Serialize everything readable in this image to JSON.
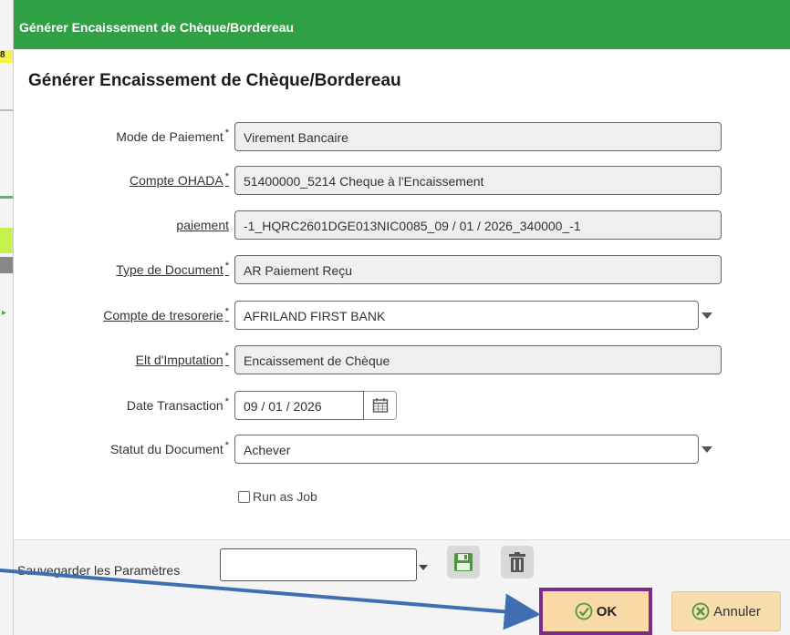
{
  "background": {
    "fragment_text": "8"
  },
  "dialog": {
    "window_title": "Générer Encaissement de Chèque/Bordereau",
    "heading": "Générer Encaissement de Chèque/Bordereau",
    "required_mark": "*",
    "fields": {
      "mode_paiement": {
        "label": "Mode de Paiement",
        "value": "Virement Bancaire"
      },
      "compte_ohada": {
        "label": "Compte OHADA",
        "value": "51400000_5214 Cheque à l'Encaissement"
      },
      "paiement": {
        "label": "paiement",
        "value": "-1_HQRC2601DGE013NIC0085_09 / 01 / 2026_340000_-1"
      },
      "type_document": {
        "label": "Type de Document",
        "value": "AR Paiement Reçu"
      },
      "compte_tresorerie": {
        "label": "Compte de tresorerie",
        "value": "AFRILAND FIRST BANK"
      },
      "elt_imputation": {
        "label": "Elt d'Imputation",
        "value": "Encaissement de Chèque"
      },
      "date_transaction": {
        "label": "Date Transaction",
        "value": "09 / 01 / 2026"
      },
      "statut_document": {
        "label": "Statut du Document",
        "value": "Achever"
      }
    },
    "run_as_job": {
      "label": "Run as Job",
      "checked": false
    },
    "footer": {
      "save_params_label": "Sauvegarder les Paramètres",
      "save_params_value": "",
      "ok_label": "OK",
      "cancel_label": "Annuler"
    }
  },
  "colors": {
    "title_bar": "#2fa043",
    "ok_highlight_border": "#7a2c88",
    "button_bg": "#f7dcae",
    "annotation_arrow": "#3f6fb0"
  },
  "icons": [
    "calendar-icon",
    "save-icon",
    "trash-icon",
    "check-icon",
    "cancel-icon",
    "chevron-down-icon"
  ]
}
